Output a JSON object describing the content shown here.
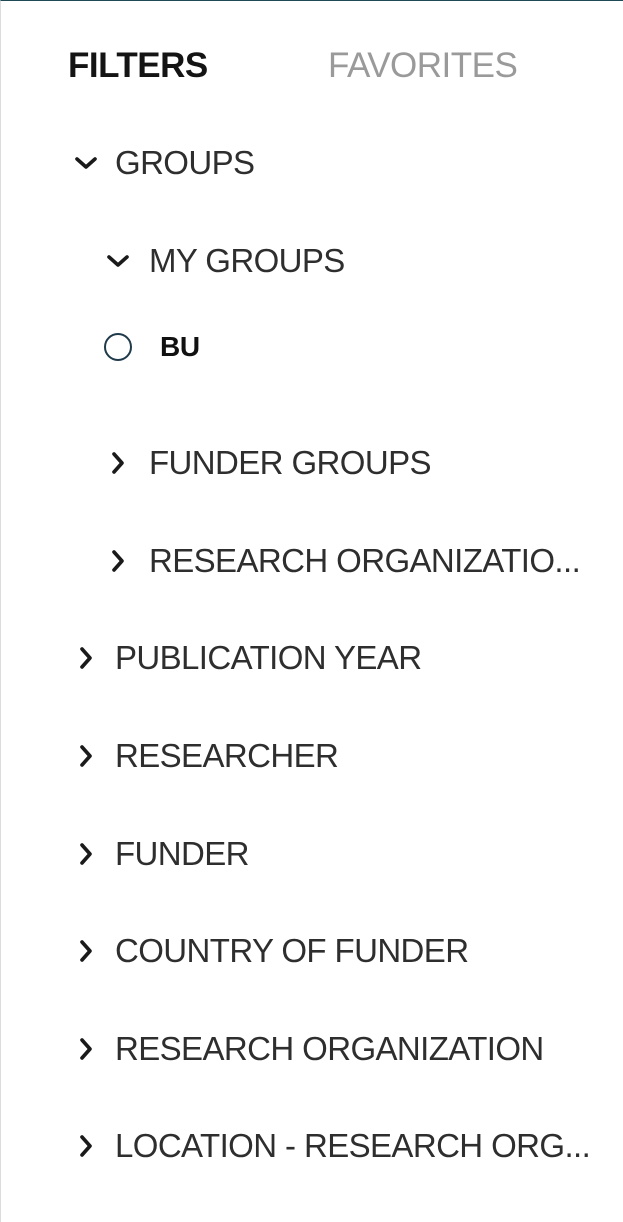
{
  "tabs": {
    "filters": "FILTERS",
    "favorites": "FAVORITES"
  },
  "tree": {
    "groups": {
      "label": "GROUPS",
      "expanded": true,
      "my_groups": {
        "label": "MY GROUPS",
        "expanded": true,
        "options": [
          {
            "label": "BU",
            "selected": false
          }
        ]
      },
      "funder_groups": {
        "label": "FUNDER GROUPS",
        "expanded": false
      },
      "research_org_groups": {
        "label": "RESEARCH ORGANIZATIO...",
        "expanded": false
      }
    },
    "publication_year": {
      "label": "PUBLICATION YEAR",
      "expanded": false
    },
    "researcher": {
      "label": "RESEARCHER",
      "expanded": false
    },
    "funder": {
      "label": "FUNDER",
      "expanded": false
    },
    "country_of_funder": {
      "label": "COUNTRY OF FUNDER",
      "expanded": false
    },
    "research_organization": {
      "label": "RESEARCH ORGANIZATION",
      "expanded": false
    },
    "location_research_org": {
      "label": "LOCATION - RESEARCH ORG...",
      "expanded": false
    }
  },
  "icons": {
    "expanded": "chevron-down-icon",
    "collapsed": "chevron-right-icon",
    "option": "radio-icon"
  },
  "colors": {
    "header_rule": "#1f4a55",
    "active_tab": "#141414",
    "inactive_tab": "#9a9a9a",
    "text": "#2e2e2e",
    "radio_border": "#1f3a4a"
  }
}
